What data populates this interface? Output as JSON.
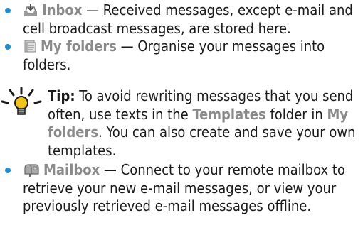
{
  "colors": {
    "bullet": "#1e8fd5",
    "term": "#8a8a8a",
    "text": "#1a1a1a",
    "tip_bulb": "#f0c419"
  },
  "items": [
    {
      "icon": "inbox-icon",
      "term": "Inbox",
      "sep": " — ",
      "desc": "Received messages, except e-mail and cell broadcast messages, are stored here."
    },
    {
      "icon": "my-folders-icon",
      "term": "My folders",
      "sep": " — ",
      "desc": "Organise your messages into folders."
    },
    {
      "icon": "mailbox-icon",
      "term": "Mailbox",
      "sep": " — ",
      "desc": "Connect to your remote mailbox to retrieve your new e-mail messages, or view your previously retrieved e-mail messages offline."
    }
  ],
  "tip": {
    "icon": "tip-lightbulb-icon",
    "label": "Tip:",
    "text_a": " To avoid rewriting messages that you send often, use texts in the ",
    "kw_templates": "Templates",
    "text_b": " folder in ",
    "kw_myfolders": "My folders",
    "text_c": ". You can also create and save your own templates."
  }
}
